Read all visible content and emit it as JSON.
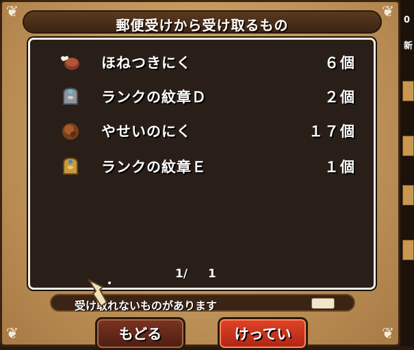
{
  "dialog": {
    "title": "郵便受けから受け取るもの",
    "items": [
      {
        "name": "ほねつきにく",
        "qty": "６個",
        "icon": "bone-meat-icon"
      },
      {
        "name": "ランクの紋章Ｄ",
        "qty": "２個",
        "icon": "silver-emblem-icon"
      },
      {
        "name": "やせいのにく",
        "qty": "１７個",
        "icon": "wild-meat-icon"
      },
      {
        "name": "ランクの紋章Ｅ",
        "qty": "１個",
        "icon": "gold-emblem-icon"
      }
    ],
    "pager": {
      "current": "1/",
      "total": "1"
    },
    "message": "受け取れないものがあります",
    "buttons": {
      "back": "もどる",
      "confirm": "けってい"
    }
  },
  "side": {
    "top_digit": "0",
    "tab_label": "新"
  },
  "colors": {
    "panel": "#c49a5f",
    "list_bg": "#2a1f18",
    "confirm": "#e04428",
    "back": "#6b2a1a"
  }
}
